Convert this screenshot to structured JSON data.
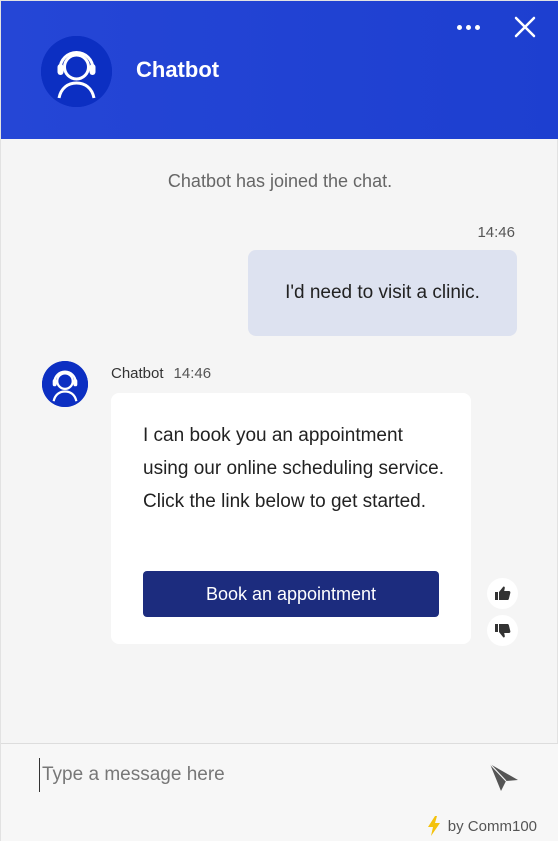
{
  "header": {
    "title": "Chatbot",
    "more_icon": "more-dots-icon",
    "close_icon": "close-icon",
    "avatar_icon": "headset-agent-icon"
  },
  "conversation": {
    "system_message": "Chatbot has joined the chat.",
    "user_message": {
      "time": "14:46",
      "text": "I'd need to visit a clinic."
    },
    "bot_message": {
      "sender": "Chatbot",
      "time": "14:46",
      "text": "I can book you an appointment using our online scheduling service. Click the link below to get started.",
      "button_label": "Book an appointment"
    },
    "rating": {
      "thumbs_up_icon": "thumbs-up-icon",
      "thumbs_down_icon": "thumbs-down-icon"
    }
  },
  "composer": {
    "placeholder": "Type a message here",
    "value": "",
    "send_icon": "send-icon",
    "powered_by": "by Comm100",
    "lightning_icon": "lightning-icon"
  },
  "colors": {
    "header_bg": "#2546d6",
    "avatar_bg": "#0c2fc2",
    "user_bubble": "#dde2f0",
    "button_bg": "#1c2c7e",
    "lightning": "#f4c20d"
  }
}
